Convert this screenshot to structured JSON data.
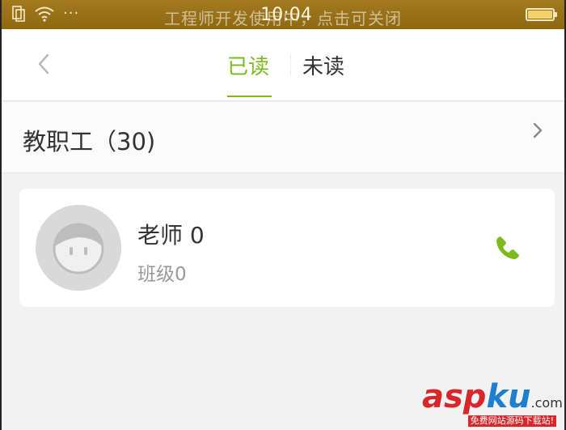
{
  "status_bar": {
    "banner": "工程师开发使用中，点击可关闭",
    "time": "10:04",
    "dots": "···",
    "icons": [
      "sim-icon",
      "wifi-icon",
      "battery-icon"
    ]
  },
  "nav": {
    "back_icon": "chevron-left-icon",
    "tabs": [
      {
        "label": "已读",
        "active": true
      },
      {
        "label": "未读",
        "active": false
      }
    ],
    "accent_color": "#7dbb1d"
  },
  "group": {
    "label": "教职工（30)",
    "chevron_icon": "chevron-right-icon"
  },
  "contacts": [
    {
      "name": "老师 0",
      "class": "班级0",
      "avatar_icon": "default-avatar-icon",
      "action_icon": "phone-icon"
    }
  ],
  "watermark": {
    "asp": "asp",
    "ku": "ku",
    "com": ".com",
    "sub": "免费网站源码下载站!"
  }
}
